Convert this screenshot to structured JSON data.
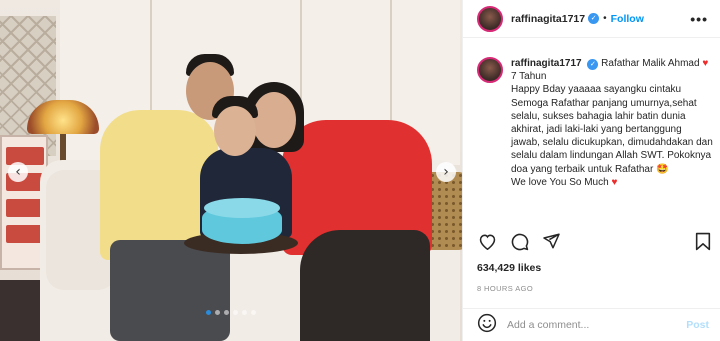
{
  "post": {
    "photo_alt": "",
    "carousel": {
      "total_dots": 6,
      "active_index": 0
    }
  },
  "header": {
    "username": "raffinagita1717",
    "separator": "•",
    "follow_label": "Follow",
    "more_label": "•••"
  },
  "caption": {
    "username": "raffinagita1717",
    "text_part1": "Rafathar Malik Ahmad",
    "heart1": "♥",
    "text_part2": "7 Tahun",
    "body": "Happy Bday yaaaaa sayangku cintaku Semoga Rafathar panjang umurnya,sehat selalu, sukses bahagia lahir batin dunia akhirat, jadi laki-laki yang bertanggung jawab, selalu dicukupkan, dimudahdakan dan selalu dalam lindungan Allah SWT. Pokoknya doa yang terbaik untuk Rafathar",
    "emoji": "🤩",
    "closing": "We love You So Much",
    "heart2": "♥"
  },
  "stats": {
    "likes": "634,429 likes",
    "time": "8 HOURS AGO"
  },
  "comment": {
    "placeholder": "Add a comment...",
    "post_label": "Post"
  },
  "nav": {
    "prev": "‹",
    "next": "›"
  },
  "colors": {
    "accent": "#0095f6",
    "heart": "#ed2b2b",
    "verified": "#3897f0"
  }
}
